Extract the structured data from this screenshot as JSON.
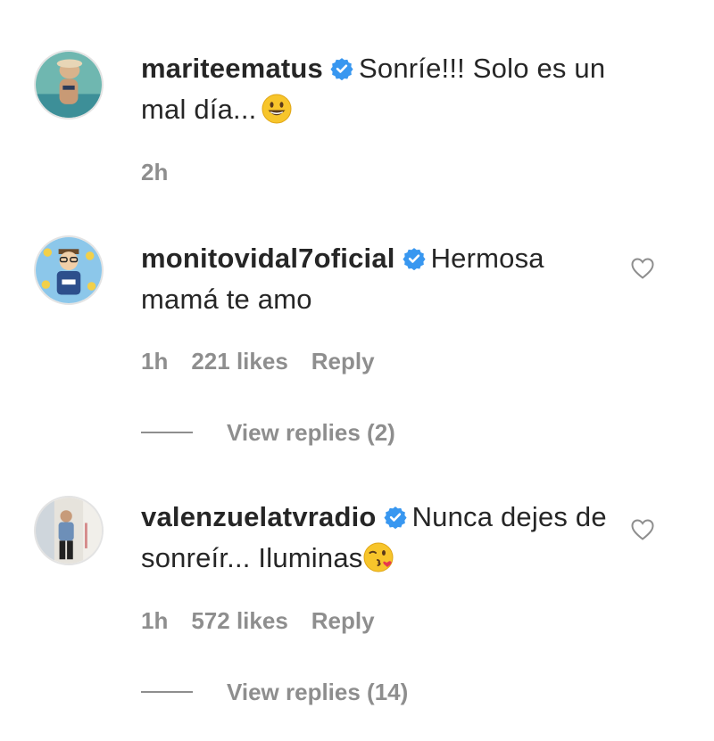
{
  "comments": [
    {
      "username": "mariteematus",
      "text": "Sonríe!!! Solo es un mal día...",
      "emoji": "smiley-emoji",
      "time": "2h",
      "likes": "",
      "reply_label": "",
      "view_replies": ""
    },
    {
      "username": "monitovidal7oficial",
      "text": "Hermosa mamá te amo",
      "time": "1h",
      "likes": "221 likes",
      "reply_label": "Reply",
      "view_replies": "View replies (2)"
    },
    {
      "username": "valenzuelatvradio",
      "text": "Nunca dejes de sonreír... Iluminas",
      "emoji": "kiss-emoji",
      "time": "1h",
      "likes": "572 likes",
      "reply_label": "Reply",
      "view_replies": "View replies (14)"
    }
  ],
  "colors": {
    "text": "#262626",
    "muted": "#8e8e8e",
    "verified": "#3897f0",
    "emoji_yellow": "#f7c52b"
  }
}
